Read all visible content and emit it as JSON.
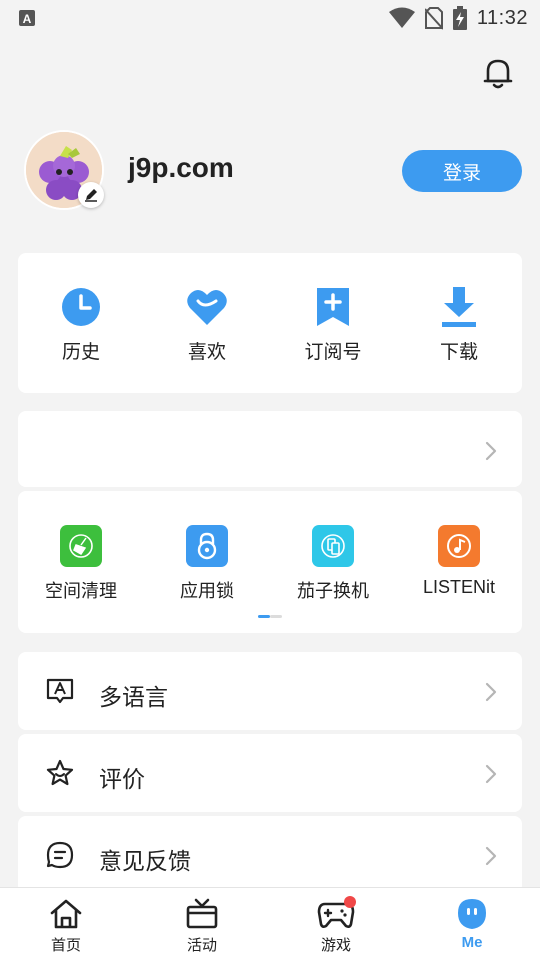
{
  "status_bar": {
    "time": "11:32",
    "icons": [
      "keyboard-a-icon",
      "wifi-icon",
      "no-sim-icon",
      "battery-charging-icon"
    ]
  },
  "header": {
    "icon": "bell-icon"
  },
  "profile": {
    "username": "j9p.com",
    "login_label": "登录",
    "avatar_icon": "grape-avatar",
    "edit_icon": "pencil-icon"
  },
  "quick_actions": [
    {
      "label": "历史",
      "icon": "clock-icon"
    },
    {
      "label": "喜欢",
      "icon": "heart-icon"
    },
    {
      "label": "订阅号",
      "icon": "bookmark-plus-icon"
    },
    {
      "label": "下载",
      "icon": "download-icon"
    }
  ],
  "apps": [
    {
      "label": "空间清理",
      "icon": "broom-icon",
      "color": "#3dbf3d"
    },
    {
      "label": "应用锁",
      "icon": "lock-icon",
      "color": "#3d9bf0"
    },
    {
      "label": "茄子换机",
      "icon": "phone-transfer-icon",
      "color": "#2ec7e8"
    },
    {
      "label": "LISTENit",
      "icon": "music-note-icon",
      "color": "#f47a2e"
    }
  ],
  "menu": [
    {
      "label": "多语言",
      "icon": "language-icon"
    },
    {
      "label": "评价",
      "icon": "star-icon"
    },
    {
      "label": "意见反馈",
      "icon": "feedback-icon"
    }
  ],
  "tabs": [
    {
      "label": "首页",
      "icon": "home-icon"
    },
    {
      "label": "活动",
      "icon": "gift-tv-icon"
    },
    {
      "label": "游戏",
      "icon": "gamepad-icon"
    },
    {
      "label": "Me",
      "icon": "me-icon"
    }
  ],
  "colors": {
    "accent": "#3d9bf0",
    "badge": "#f04848"
  }
}
